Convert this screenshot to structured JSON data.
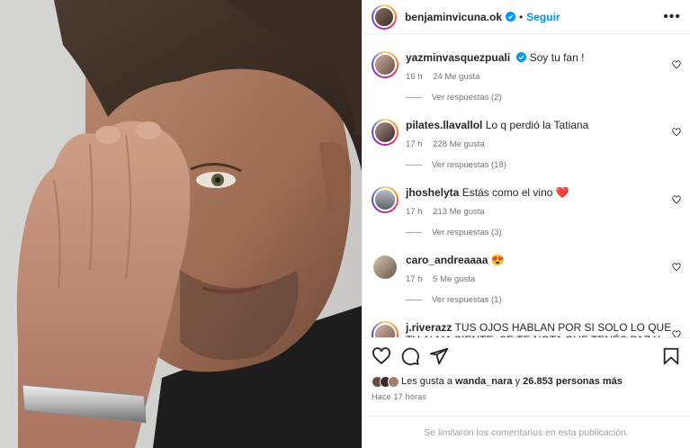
{
  "post": {
    "author": "benjaminvicuna.ok",
    "follow_label": "Seguir",
    "separator": "•",
    "more_label": "•••"
  },
  "comments": [
    {
      "user": "yazminvasquezpuali",
      "verified": true,
      "text": "Soy tu fan !",
      "time": "16 h",
      "likes": "24 Me gusta",
      "replies": "Ver respuestas (2)"
    },
    {
      "user": "pilates.llavallol",
      "verified": false,
      "text": "Lo q perdió la Tatiana",
      "time": "17 h",
      "likes": "228 Me gusta",
      "replies": "Ver respuestas (18)"
    },
    {
      "user": "jhoshelyta",
      "verified": false,
      "text": "Estás como el vino",
      "emoji": "❤️",
      "time": "17 h",
      "likes": "213 Me gusta",
      "replies": "Ver respuestas (3)"
    },
    {
      "user": "caro_andreaaaa",
      "verified": false,
      "text": "",
      "emoji": "😍",
      "time": "17 h",
      "likes": "5 Me gusta",
      "replies": "Ver respuestas (1)"
    },
    {
      "user": "j.riverazz",
      "verified": false,
      "text": "TUS OJOS HABLAN POR SI SOLO LO QUE TU ALMA SIENTE. SE TE NOTA QUE TENÉS PAZ Y MUCJO AMOR PARA DAR. ESTÁS DESEANDO TU FAMILIA UNA CASITA"
    }
  ],
  "likes": {
    "prefix": "Les gusta a",
    "user": "wanda_nara",
    "connector": "y",
    "count": "26.853 personas más"
  },
  "time_ago": "Hace 17 horas",
  "comments_limited": "Se limitaron los comentarios en esta publicación.",
  "icons": {
    "like": "heart-icon",
    "comment": "comment-icon",
    "share": "share-icon",
    "save": "bookmark-icon",
    "verified": "verified-badge-icon"
  },
  "colors": {
    "accent": "#0095f6",
    "verified": "#0095f6",
    "muted": "#737373",
    "heart": "#e0245e"
  }
}
